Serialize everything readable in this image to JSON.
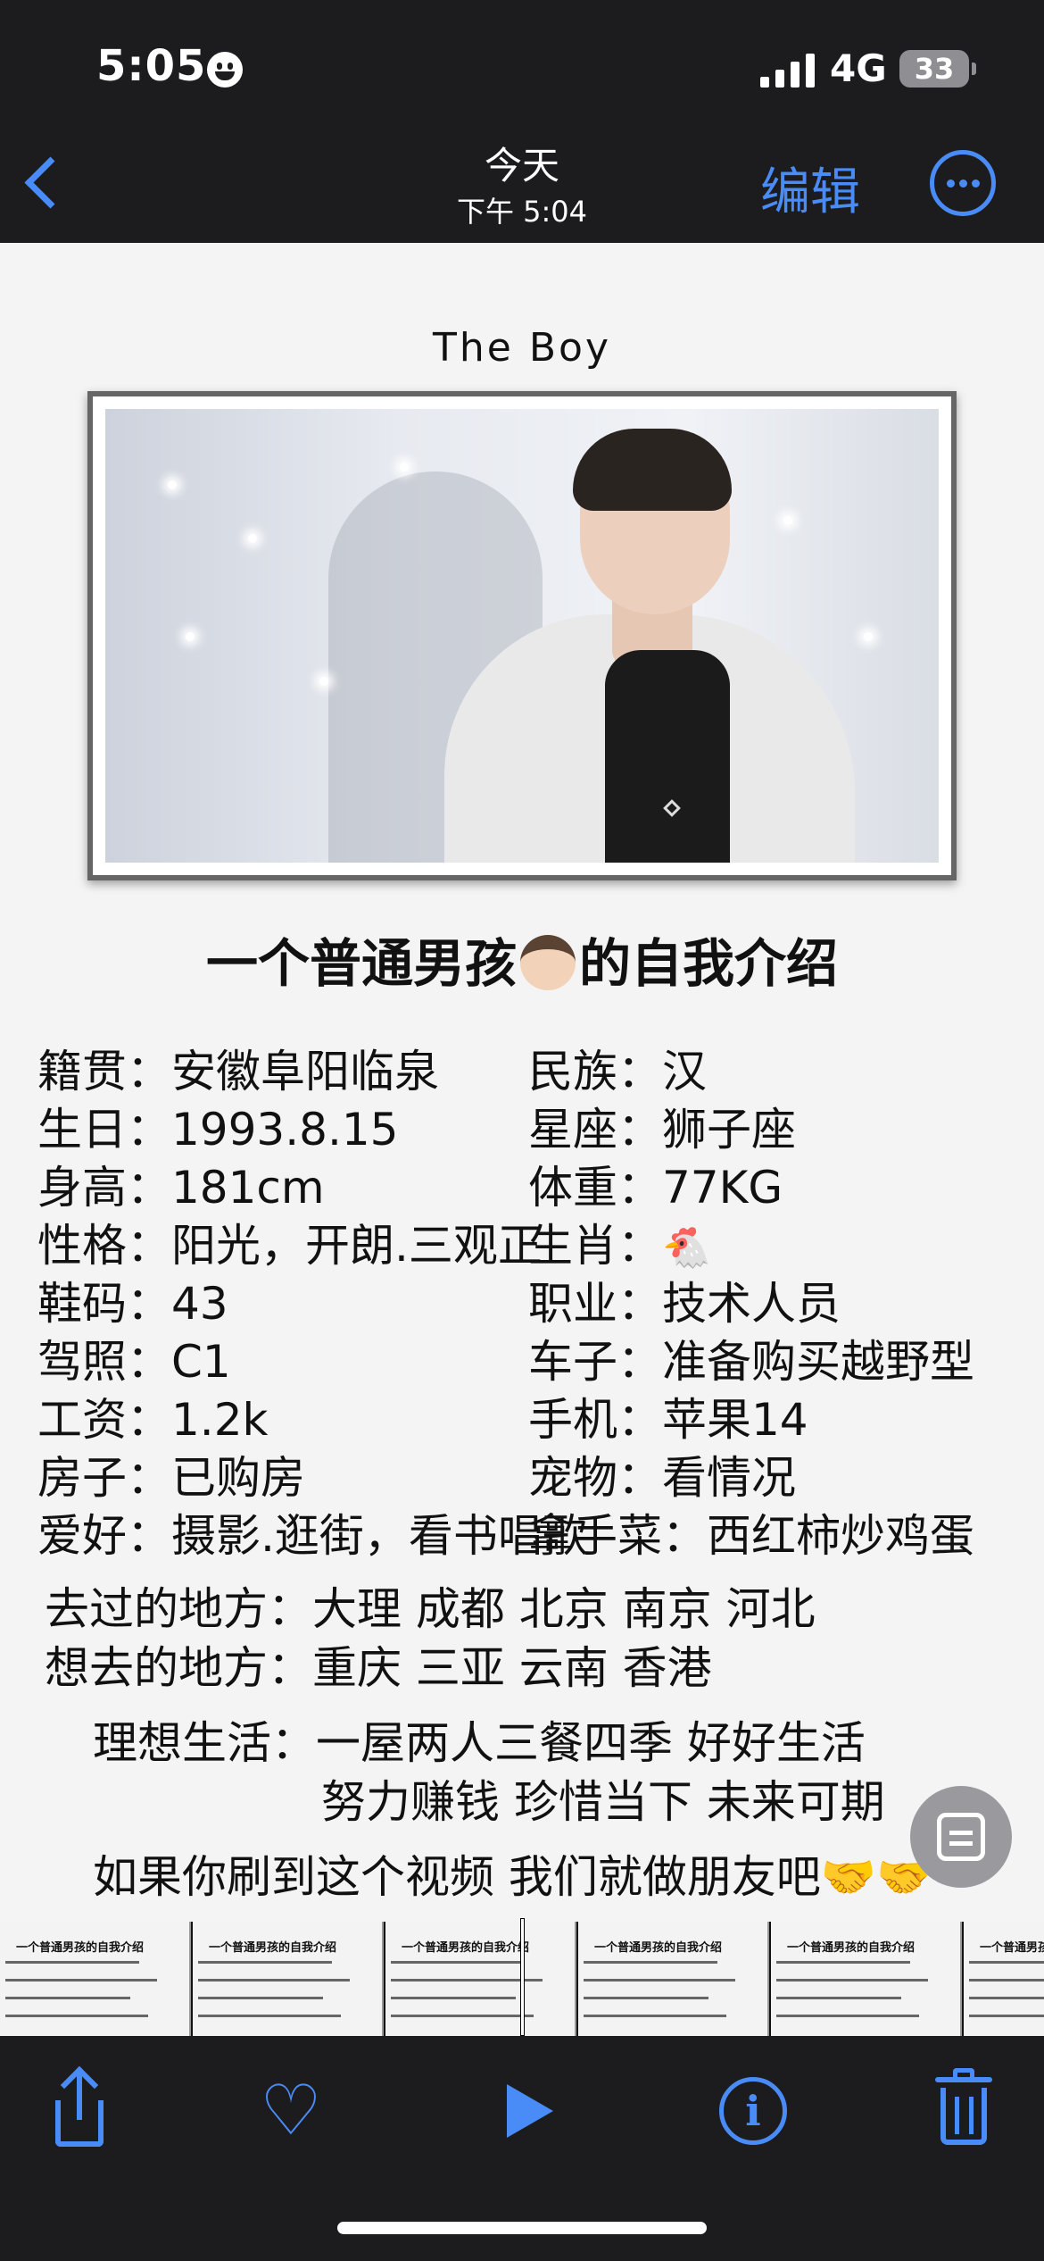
{
  "status_bar": {
    "time": "5:05",
    "network": "4G",
    "battery": "33"
  },
  "nav": {
    "title": "今天",
    "subtitle": "下午 5:04",
    "edit_label": "编辑"
  },
  "photo": {
    "title": "The Boy",
    "headline_before": "一个普通男孩",
    "headline_after": "的自我介绍",
    "left_col": [
      {
        "label": "籍贯：",
        "value": "安徽阜阳临泉"
      },
      {
        "label": "生日：",
        "value": "1993.8.15"
      },
      {
        "label": "身高：",
        "value": "181cm"
      },
      {
        "label": "性格：",
        "value": "阳光，开朗.三观正"
      },
      {
        "label": "鞋码：",
        "value": "43"
      },
      {
        "label": "驾照：",
        "value": "C1"
      },
      {
        "label": "工资：",
        "value": "1.2k"
      },
      {
        "label": "房子：",
        "value": "已购房"
      },
      {
        "label": "爱好：",
        "value": "摄影.逛街，看书唱歌"
      }
    ],
    "right_col": [
      {
        "label": "民族：",
        "value": "汉"
      },
      {
        "label": "星座：",
        "value": "狮子座"
      },
      {
        "label": "体重：",
        "value": "77KG"
      },
      {
        "label": "生肖：",
        "value": "🐔"
      },
      {
        "label": "职业：",
        "value": "技术人员"
      },
      {
        "label": "车子：",
        "value": "准备购买越野型"
      },
      {
        "label": "手机：",
        "value": "苹果14"
      },
      {
        "label": "宠物：",
        "value": "看情况"
      },
      {
        "label": "拿手菜：",
        "value": "西红柿炒鸡蛋"
      }
    ],
    "visited": {
      "label": "去过的地方：",
      "value": "大理 成都 北京 南京 河北"
    },
    "want": {
      "label": "想去的地方：",
      "value": "重庆 三亚 云南 香港"
    },
    "ideal": {
      "label": "理想生活：",
      "line1": "一屋两人三餐四季 好好生活",
      "line2": "努力赚钱 珍惜当下 未来可期"
    },
    "closing": "如果你刷到这个视频 我们就做朋友吧🤝🤝"
  },
  "strip": {
    "thumb_title": "一个普通男孩的自我介绍"
  },
  "icons": {
    "back": "chevron-left-icon",
    "more": "ellipsis-circle-icon",
    "share": "share-icon",
    "favorite": "heart-icon",
    "play": "play-icon",
    "info": "info-icon",
    "delete": "trash-icon",
    "live_text": "live-text-scan-icon"
  },
  "colors": {
    "accent": "#4a8cf7",
    "bars": "#1c1c1e",
    "photo_bg": "#f4f4f4"
  }
}
